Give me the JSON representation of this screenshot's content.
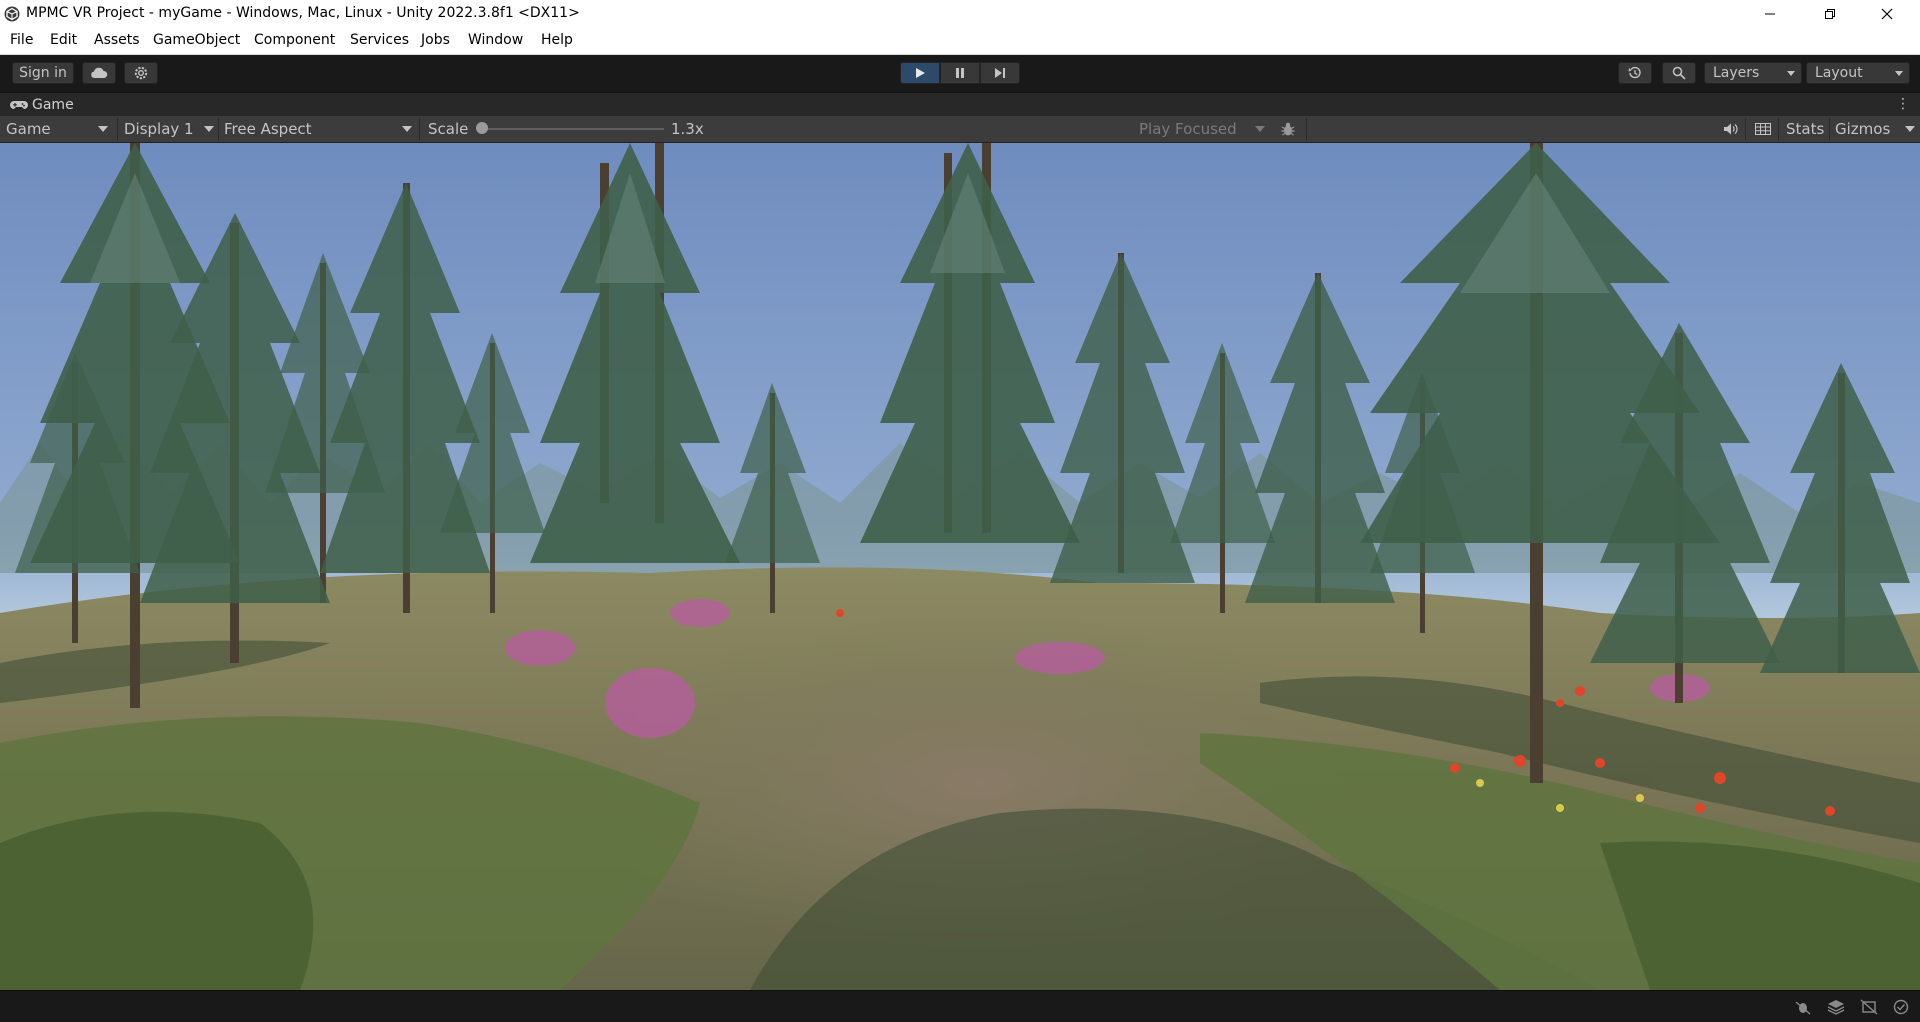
{
  "window": {
    "title": "MPMC VR Project - myGame - Windows, Mac, Linux - Unity 2022.3.8f1 <DX11>"
  },
  "menu": [
    "File",
    "Edit",
    "Assets",
    "GameObject",
    "Component",
    "Services",
    "Jobs",
    "Window",
    "Help"
  ],
  "toolbar": {
    "sign_in": "Sign in",
    "layers": "Layers",
    "layout": "Layout",
    "play_active": true
  },
  "tab": {
    "label": "Game"
  },
  "game_toolbar": {
    "view": "Game",
    "display": "Display 1",
    "aspect": "Free Aspect",
    "scale_label": "Scale",
    "scale_value": "1.3x",
    "play_focused": "Play Focused",
    "stats": "Stats",
    "gizmos": "Gizmos"
  },
  "icons": {
    "app": "unity-logo-icon",
    "cloud": "cloud-icon",
    "settings": "gear-icon",
    "history": "history-icon",
    "search": "search-icon",
    "bug": "bug-icon",
    "audio": "speaker-icon",
    "grid": "grid-icon",
    "status": [
      "debug-icon",
      "layers-icon",
      "network-off-icon",
      "check-circle-icon"
    ]
  },
  "colors": {
    "editor_bg": "#191919",
    "play_active": "#2d4a6a",
    "sky_top": "#6f8cbf",
    "sky_horizon": "#c5d8e4",
    "ground": "#7d7b58"
  }
}
